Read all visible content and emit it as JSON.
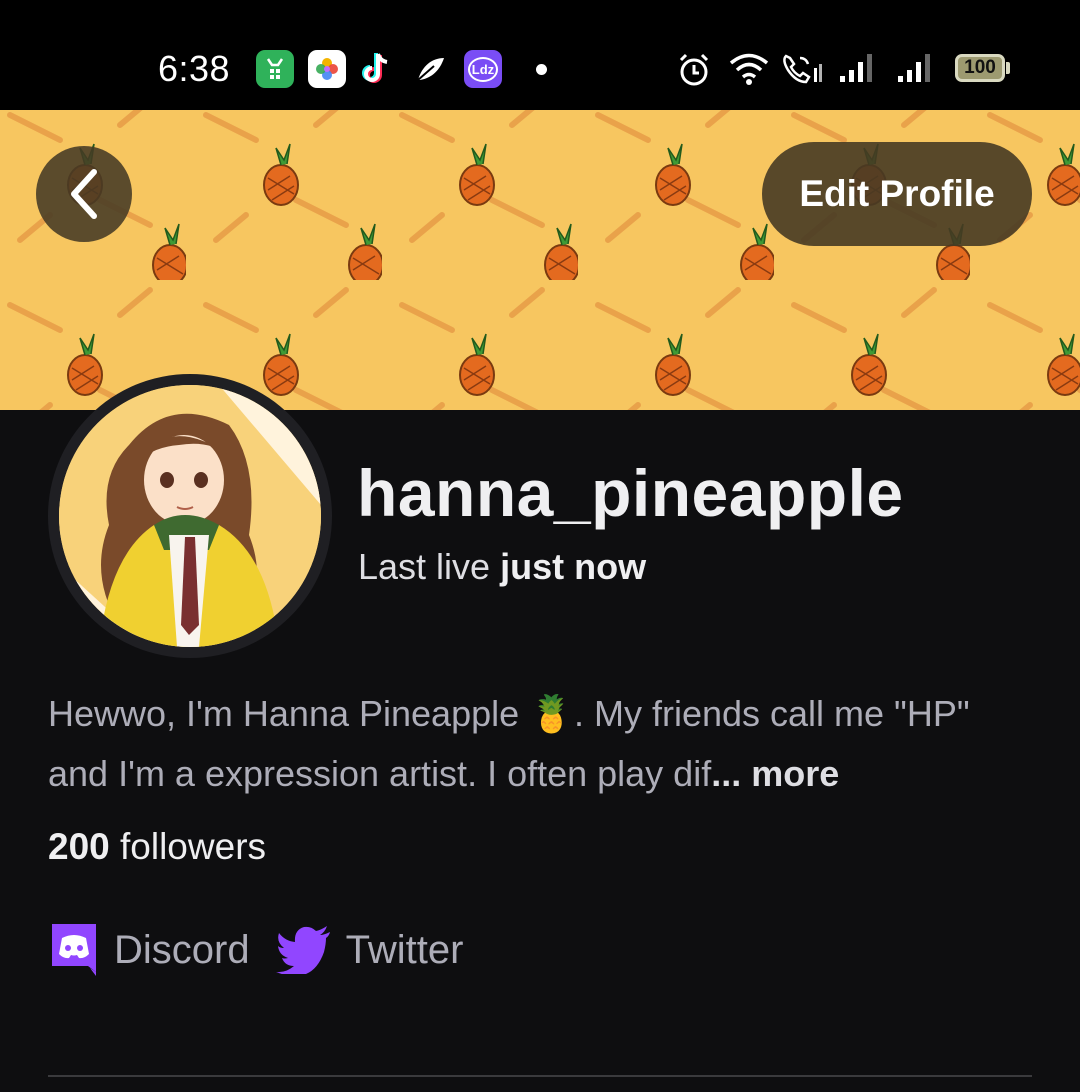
{
  "status_bar": {
    "time": "6:38",
    "battery": "100",
    "apps": [
      "app-icon-green",
      "photos-icon",
      "tiktok-icon",
      "feather-icon",
      "ldz-icon"
    ],
    "ldz_label": "Ldz"
  },
  "header": {
    "back_icon": "chevron-left-icon",
    "edit_profile_label": "Edit Profile"
  },
  "profile": {
    "username": "hanna_pineapple",
    "last_live_prefix": "Last live ",
    "last_live_value": "just now",
    "bio_text": "Hewwo, I'm Hanna Pineapple 🍍. My friends call me \"HP\" and I'm a expression artist. I often play dif",
    "bio_more": "... more",
    "followers_count": "200",
    "followers_label": " followers"
  },
  "socials": [
    {
      "name": "Discord",
      "icon": "discord-icon"
    },
    {
      "name": "Twitter",
      "icon": "twitter-icon"
    }
  ],
  "colors": {
    "background": "#0e0e10",
    "banner": "#f7c660",
    "accent_purple": "#9146ff"
  }
}
